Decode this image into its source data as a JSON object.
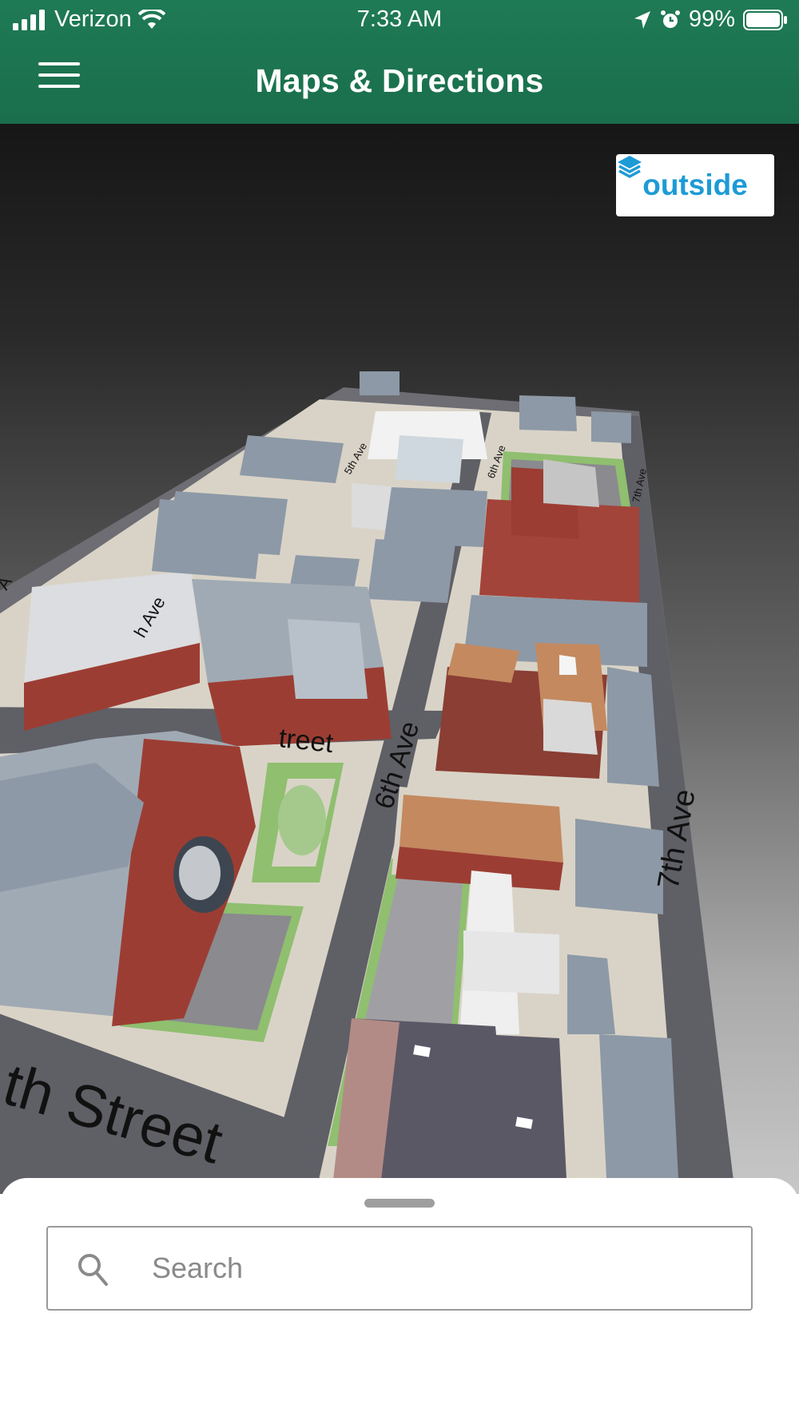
{
  "status_bar": {
    "carrier": "Verizon",
    "time": "7:33 AM",
    "battery": "99%",
    "icons": [
      "signal-icon",
      "wifi-icon",
      "location-arrow-icon",
      "alarm-icon",
      "battery-icon"
    ]
  },
  "header": {
    "title": "Maps & Directions",
    "menu_icon": "hamburger-menu-icon",
    "background_color": "#1e7a55"
  },
  "map": {
    "layer_button_label": "outside",
    "layer_icon": "layers-icon",
    "layer_accent_color": "#1d9bd6",
    "street_labels": {
      "street": "th Street",
      "street_mid": "treet",
      "avenue_6": "6th Ave",
      "avenue_7": "7th Ave",
      "avenue_5_small": "5th Ave",
      "avenue_6_small": "6th Ave",
      "avenue_7_small": "7th Ave",
      "avenue_left_a": "A",
      "avenue_left_b": "h Ave"
    }
  },
  "bottom_sheet": {
    "search_placeholder": "Search",
    "search_value": "",
    "search_icon": "search-icon"
  }
}
